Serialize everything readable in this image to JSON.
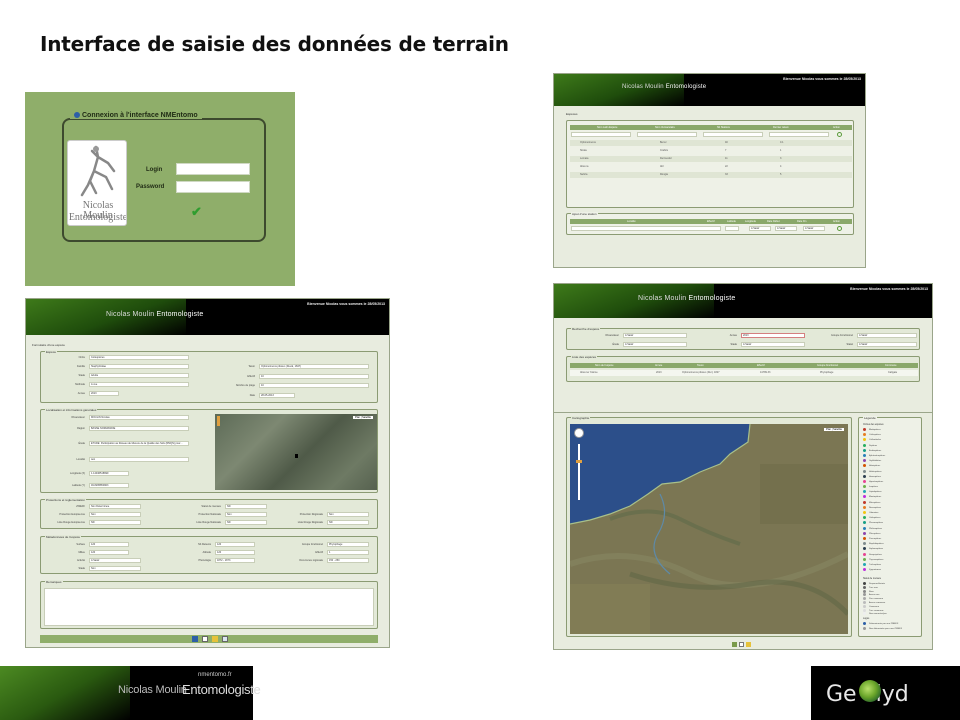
{
  "slide": {
    "title": "Interface de saisie des données de terrain"
  },
  "login": {
    "legend": "Connexion à l'interface NMEntomo",
    "login_label": "Login",
    "password_label": "Password",
    "logo_line1": "Nicolas Moulin",
    "logo_line2": "Entomologiste"
  },
  "header": {
    "site": "nmentomo.fr",
    "brand_part1": "Nicolas Moulin",
    "brand_part2": "Entomologiste",
    "welcome": "Bienvenue Nicolas vous sommes le 28/05/2013"
  },
  "form_screen": {
    "page_title": "Formulaire d'une espèce",
    "sections": {
      "taxon": "Espèce",
      "location": "Localisation et informations générales",
      "protection": "Protections et réglementation",
      "metadata": "Métadonnées de l'espèce",
      "remarks": "Remarques"
    },
    "labels": {
      "ordre": "Ordre",
      "famille": "Famille",
      "stade": "Stade",
      "methode": "Méthode",
      "annee": "Année",
      "taxon": "Taxon",
      "effectif": "Effectif",
      "nombre_piege": "Nombre de piège",
      "date": "Date",
      "observateur": "Observateur",
      "region": "Région",
      "etude": "Étude",
      "localite": "Localité",
      "longitude": "Longitude (X)",
      "latitude": "Latitude (Y)",
      "znieff": "ZNIEFF",
      "protection_europeenne": "Protection Européenne",
      "liste_rouge_europeenne": "Liste Rouge Européenne",
      "statut_ue": "Statut de menace",
      "protection_nationale": "Protection Nationale",
      "liste_rouge_nationale": "Liste Rouge Nationale",
      "protection_regionale": "Protection Régionale",
      "liste_rouge_regionale": "Liste Rouge Régionale",
      "surface": "Surface",
      "milieu": "Milieu",
      "altitude": "Altitude",
      "nb_releve": "Nb Relevés",
      "groupe_fonctionnel": "Groupe fonctionnel",
      "phenologie": "Phénologie",
      "activite": "Activité",
      "occurrence": "Occurrence régionale"
    },
    "values": {
      "ordre": "Coléoptères",
      "famille": "Staphylinidae",
      "stade": "Adulte",
      "methode": "A vue",
      "annee": "2013",
      "taxon": "Ophonomerus pilosus (Duval, 1847)",
      "effectif": "10",
      "nombre_piege": "10",
      "date": "28-05-2013",
      "observateur": "MOULIN Nicolas",
      "region": "BASSE NORMANDIE",
      "etude": "ETUDE: Participation au Réseau de Mesure de la Qualité des Sols (RMQS) pour...",
      "localite": "test",
      "longitude": "1.14046518699",
      "latitude": "49.8295850903",
      "choice_non_determine": "Non Déterminée",
      "choice_non": "Non",
      "choice_nd": "ND",
      "val_120": "120",
      "val_1": "1",
      "choice_select": "A Saisir",
      "groupe": "Phytophage",
      "date_range": "1872 - 1873",
      "occ": "150 - 250"
    },
    "map_type": {
      "plan": "Plan",
      "satellite": "Satellite"
    }
  },
  "list_screen": {
    "section_title": "Espèces",
    "columns": [
      "Nom Latin Espèce",
      "Nom Vernaculaire",
      "Nb Stations",
      "Dernier relevé",
      "Action"
    ],
    "rows": [
      [
        "Ophonomerus",
        "Benvr",
        "40",
        "0.1"
      ],
      [
        "Strata",
        "Crabris",
        "7",
        "1"
      ],
      [
        "Lomata",
        "Dermestid",
        "11",
        "3"
      ],
      [
        "Abax ia",
        "Abl",
        "22",
        "4"
      ],
      [
        "Nebria",
        "Rongia",
        "33",
        "5"
      ]
    ],
    "new_entry": "Ajout d'une station",
    "new_columns": [
      "Localité",
      "Effectif",
      "Latitude",
      "Longitude",
      "Date Début",
      "Date Fin",
      "Action"
    ],
    "new_selects": [
      "A Saisir",
      "A Saisir",
      "A Saisir"
    ]
  },
  "search_screen": {
    "section_title": "Recherche d'espèce",
    "labels": {
      "observateur": "Observateur",
      "annee": "Année",
      "groupe_fonctionnel": "Groupe Fonctionnel",
      "etude": "Étude",
      "stade": "Stade",
      "statut": "Statut"
    },
    "values": {
      "choice_select": "A Saisir",
      "annee": "2013"
    },
    "list_title": "Liste des espèces",
    "columns": [
      "Nom de l'espèce",
      "Année",
      "Taxon",
      "Effectif",
      "Groupe fonctionnel",
      "Commune"
    ],
    "row": [
      "Abax ter 31ème",
      "2013",
      "Ophonomerus pilosus (Dur.) 1827",
      "41789.33",
      "Phytophage",
      "Caligate"
    ]
  },
  "map_screen": {
    "section_title": "Cartographie",
    "map_plan": "Plan",
    "map_satellite": "Satellite",
    "legend_title": "Légende",
    "legend_group_title": "Ordres des espèces",
    "legend_items": [
      "Blattoptères",
      "Coléoptères",
      "Collemboles",
      "Diptères",
      "Embioptères",
      "Ephéméroptères",
      "Grylloblattes",
      "Hémiptères",
      "Hétéroptères",
      "Homoptères",
      "Hyménoptères",
      "Isoptères",
      "Lépidoptères",
      "Mantoptères",
      "Mécoptères",
      "Neuroptères",
      "Odonates",
      "Orthoptères",
      "Phasmoptères",
      "Phthiraptères",
      "Plécoptères",
      "Psocoptères",
      "Raphidioptères",
      "Siphonaptères",
      "Strepsiptères",
      "Thysanoptères",
      "Trichoptères",
      "Zygentomes"
    ],
    "status_title": "Statut de menace",
    "status_items": [
      "Disparue/éteinte",
      "Tres rare",
      "Rare",
      "Assez rare",
      "Peu commune",
      "Assez commune",
      "Commune",
      "Tres commune",
      "Non menacée/pas"
    ],
    "logo_title": "Logos",
    "logo_items": [
      "Déterminants par une ZNIEFF",
      "Non déterminée pour une ZNIEFF"
    ]
  },
  "footer": {
    "site": "nmentomo.fr",
    "name_part1": "Nicolas Moulin",
    "name_part2": "Entomologiste",
    "partner_logo": "Ge clyd"
  }
}
